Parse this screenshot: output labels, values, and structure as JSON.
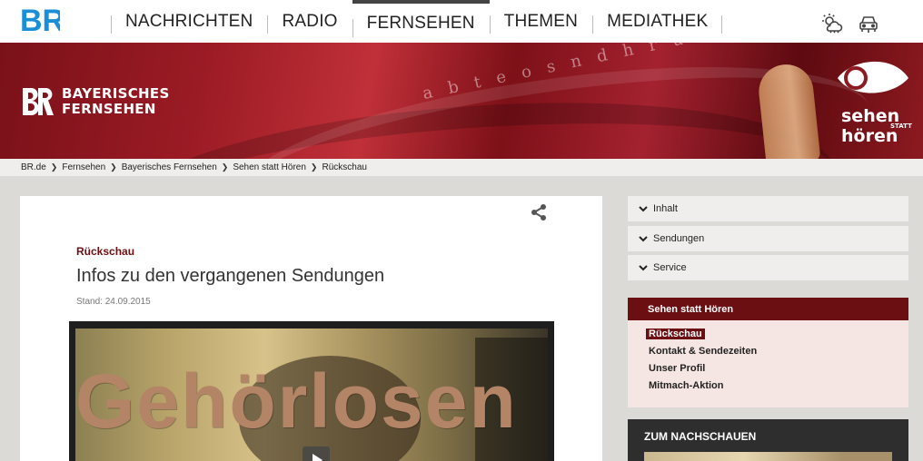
{
  "nav": {
    "items": [
      {
        "label": "NACHRICHTEN",
        "active": false
      },
      {
        "label": "RADIO",
        "active": false
      },
      {
        "label": "FERNSEHEN",
        "active": true
      },
      {
        "label": "THEMEN",
        "active": false
      },
      {
        "label": "MEDIATHEK",
        "active": false
      }
    ],
    "icons": [
      "weather-icon",
      "traffic-icon"
    ]
  },
  "logos": {
    "br": "BR",
    "channel": [
      "BAYERISCHES",
      "FERNSEHEN"
    ],
    "show_line1": "sehen",
    "show_small": "STATT",
    "show_line2": "hören"
  },
  "breadcrumb": [
    "BR.de",
    "Fernsehen",
    "Bayerisches Fernsehen",
    "Sehen statt Hören",
    "Rückschau"
  ],
  "article": {
    "kicker": "Rückschau",
    "title": "Infos zu den vergangenen Sendungen",
    "stand": "Stand: 24.09.2015",
    "video_word": "Gehörlosen"
  },
  "sidebar": {
    "accordion": [
      "Inhalt",
      "Sendungen",
      "Service"
    ],
    "section_title": "Sehen statt Hören",
    "links": [
      {
        "label": "Rückschau",
        "active": true
      },
      {
        "label": "Kontakt & Sendezeiten",
        "active": false
      },
      {
        "label": "Unser Profil",
        "active": false
      },
      {
        "label": "Mitmach-Aktion",
        "active": false
      }
    ],
    "dark_title": "ZUM NACHSCHAUEN"
  },
  "colors": {
    "accent": "#6b0f12",
    "br_blue": "#1a8ed6",
    "banner": "#9b1b24"
  }
}
